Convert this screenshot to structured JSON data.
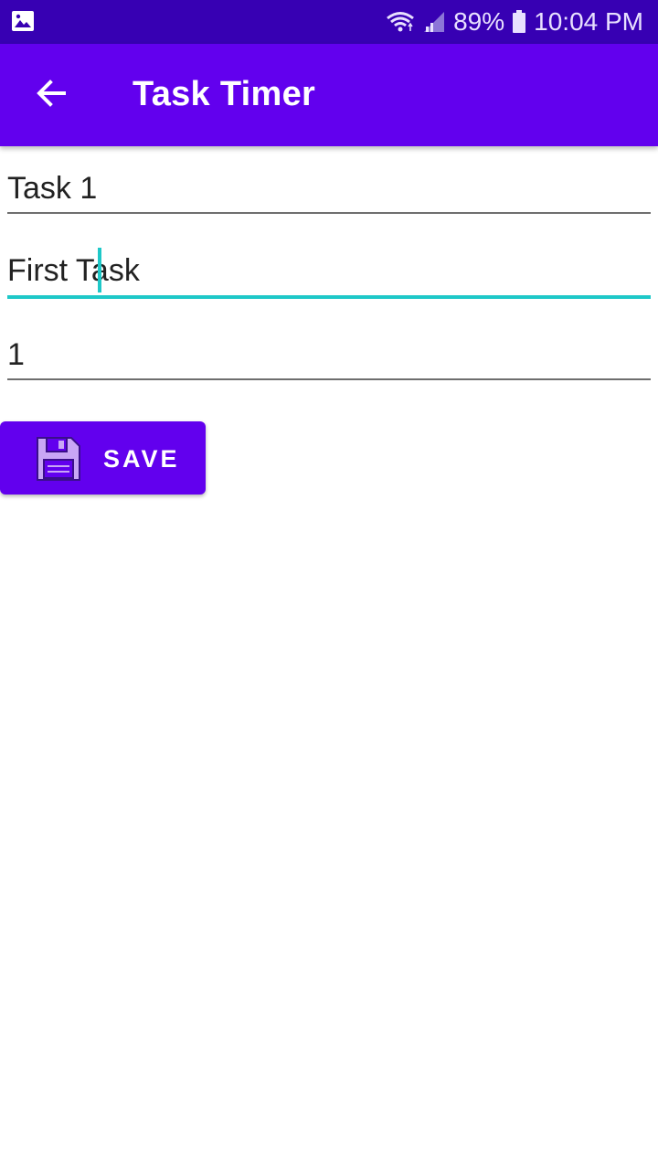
{
  "status_bar": {
    "battery_percent": "89%",
    "time": "10:04 PM",
    "left_icon": "image-icon",
    "wifi_icon": "wifi-icon",
    "signal_icon": "signal-icon",
    "battery_icon": "battery-icon"
  },
  "app_bar": {
    "title": "Task Timer",
    "back_icon": "arrow-back-icon",
    "color": "#6200ee"
  },
  "form": {
    "name_value": "Task 1",
    "description_value": "First Task",
    "sort_order_value": "1",
    "focus_color": "#1ec8c8"
  },
  "save_button": {
    "label": "SAVE",
    "icon": "floppy-disk-icon"
  }
}
